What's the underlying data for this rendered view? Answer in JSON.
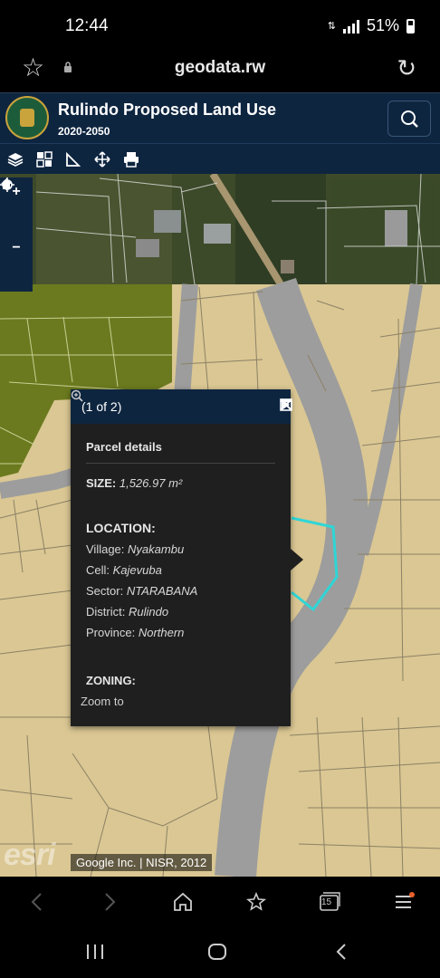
{
  "status": {
    "time": "12:44",
    "battery": "51%"
  },
  "browser": {
    "url": "geodata.rw",
    "tab_count": "15"
  },
  "app": {
    "title": "Rulindo Proposed Land Use",
    "subtitle": "2020-2050"
  },
  "toolbar": {
    "tools": [
      "layers-icon",
      "basemap-gallery-icon",
      "measure-icon",
      "move-icon",
      "print-icon"
    ]
  },
  "map_controls": {
    "zoom_in": "+",
    "home": "home-icon",
    "zoom_out": "−",
    "locate": "locate-icon"
  },
  "popup": {
    "count": "(1 of 2)",
    "title": "Parcel details",
    "size_label": "SIZE:",
    "size_value": "1,526.97 m²",
    "location_heading": "LOCATION:",
    "village_label": "Village:",
    "village_value": "Nyakambu",
    "cell_label": "Cell:",
    "cell_value": "Kajevuba",
    "sector_label": "Sector:",
    "sector_value": "NTARABANA",
    "district_label": "District:",
    "district_value": "Rulindo",
    "province_label": "Province:",
    "province_value": "Northern",
    "zoning_heading": "ZONING:",
    "zoom_to": "Zoom to"
  },
  "map": {
    "attribution": "Google Inc. | NISR, 2012",
    "esri_logo": "esri",
    "colors": {
      "parcel": "#dac793",
      "road": "#9d9d9d",
      "agriculture": "#6b7a1e",
      "highlight": "#2fd6d6",
      "header": "#0e2540"
    }
  }
}
